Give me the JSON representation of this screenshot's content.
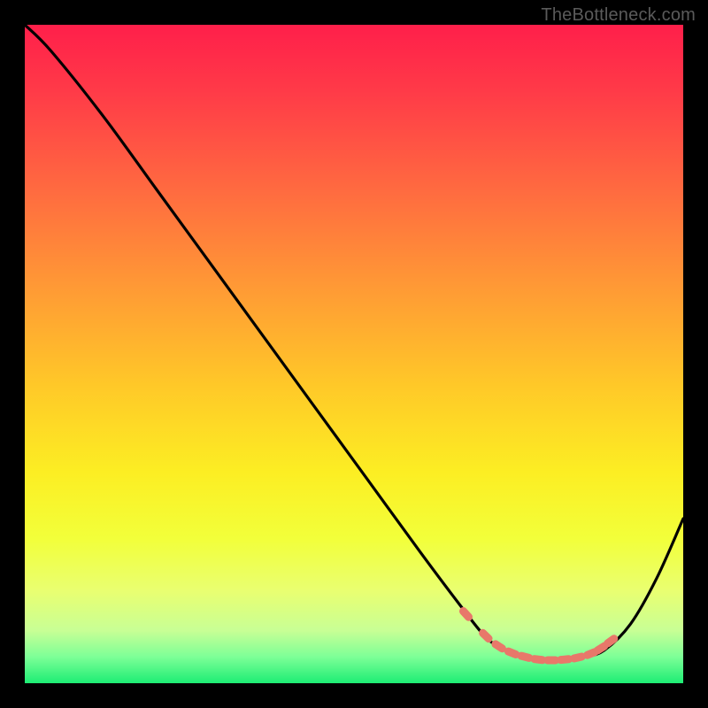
{
  "watermark": "TheBottleneck.com",
  "colors": {
    "frame_bg": "#000000",
    "line": "#000000",
    "markers": "#e8786a"
  },
  "chart_data": {
    "type": "line",
    "title": "",
    "xlabel": "",
    "ylabel": "",
    "xlim": [
      0,
      100
    ],
    "ylim": [
      0,
      100
    ],
    "x": [
      0,
      4,
      12,
      20,
      28,
      36,
      44,
      52,
      60,
      66,
      70,
      73,
      76,
      79,
      82,
      85,
      88,
      92,
      96,
      100
    ],
    "y": [
      100,
      96,
      86,
      75,
      64,
      53,
      42,
      31,
      20,
      12,
      7,
      5,
      4,
      3.5,
      3.5,
      4,
      5,
      9,
      16,
      25
    ],
    "markers": {
      "x": [
        67,
        70,
        72,
        74,
        76,
        78,
        80,
        82,
        84,
        86,
        87.5,
        89
      ],
      "y": [
        10.5,
        7.2,
        5.6,
        4.6,
        4.0,
        3.6,
        3.5,
        3.6,
        3.9,
        4.5,
        5.3,
        6.4
      ]
    }
  }
}
